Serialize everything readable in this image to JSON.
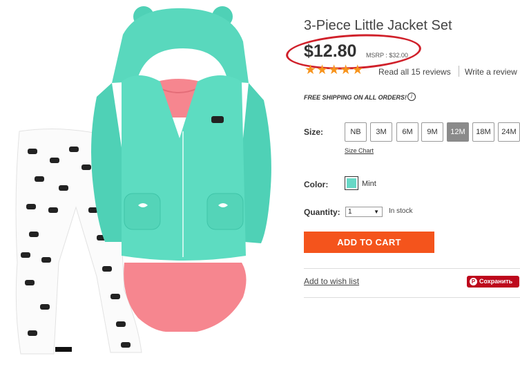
{
  "product": {
    "title": "3-Piece Little Jacket Set",
    "price": "$12.80",
    "msrp": "MSRP : $32.00",
    "rating_stars": 5,
    "read_reviews": "Read all 15 reviews",
    "write_review": "Write a review",
    "free_shipping": "FREE SHIPPING ON ALL ORDERS!",
    "info_icon": "i"
  },
  "size": {
    "label": "Size:",
    "options": [
      "NB",
      "3M",
      "6M",
      "9M",
      "12M",
      "18M",
      "24M"
    ],
    "selected": "12M",
    "size_chart": "Size Chart"
  },
  "color": {
    "label": "Color:",
    "name": "Mint",
    "swatch_hex": "#68d8c6"
  },
  "quantity": {
    "label": "Quantity:",
    "value": "1",
    "stock": "In stock"
  },
  "actions": {
    "add_to_cart": "ADD TO CART",
    "wishlist": "Add to wish list",
    "pinterest": "Сохранить",
    "pinterest_icon": "P"
  },
  "colors": {
    "accent_orange": "#f4541c",
    "stars": "#f7941d",
    "pinterest_red": "#bd081c",
    "annotation_circle": "#d0202a"
  }
}
